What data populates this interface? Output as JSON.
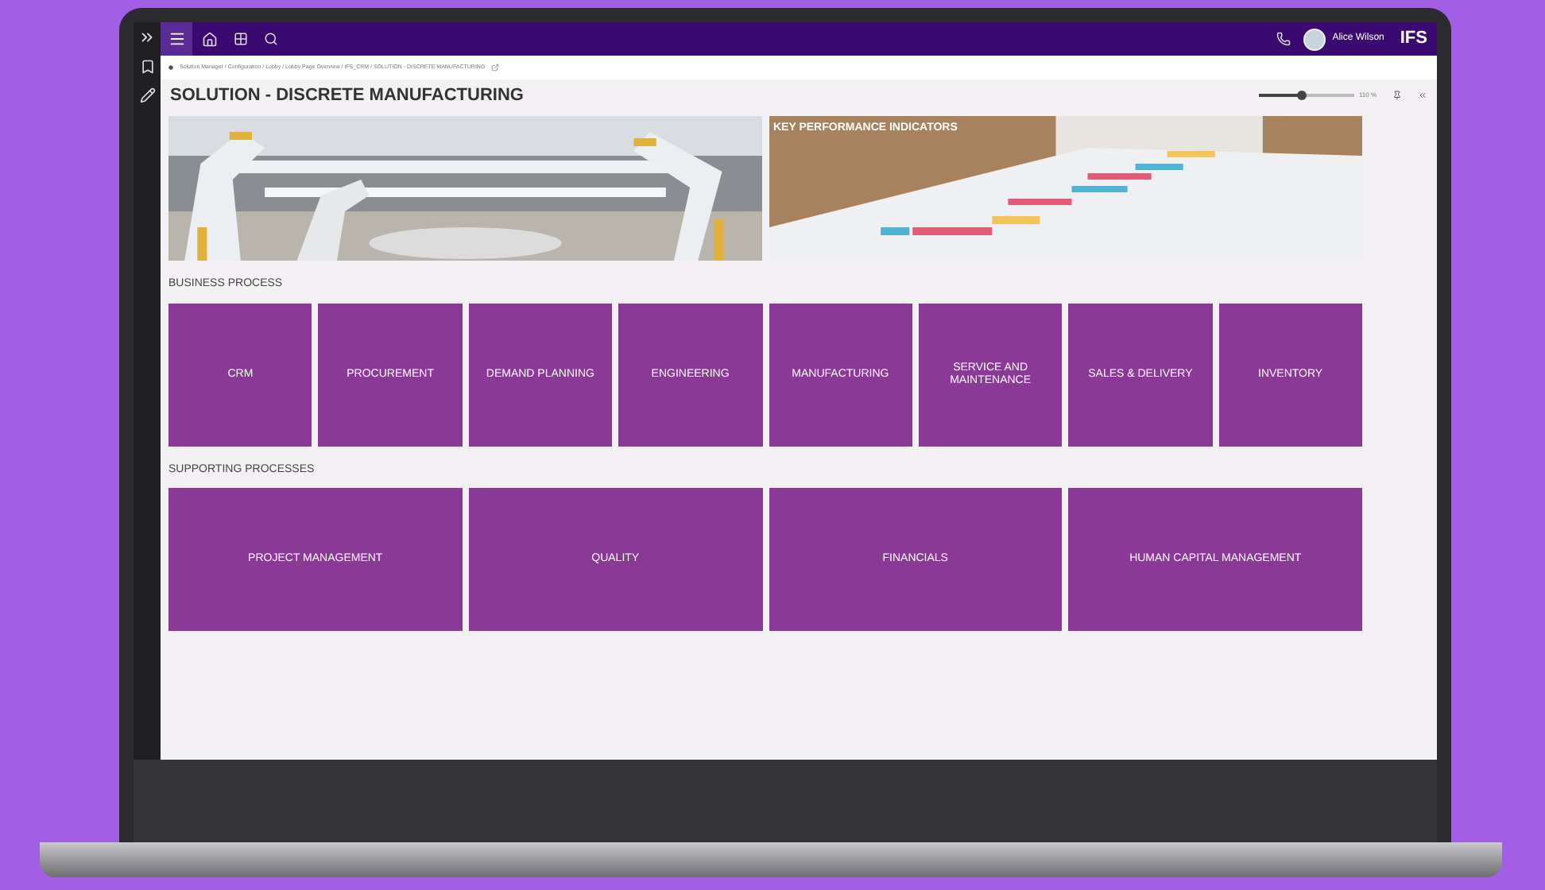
{
  "topbar": {
    "user": "Alice Wilson",
    "logo": "IFS"
  },
  "breadcrumb": "Solution Manager / Configuration / Lobby / Lobby Page Overview / IFS_CRM / SOLUTION - DISCRETE MANUFACTURING",
  "title": "SOLUTION - DISCRETE MANUFACTURING",
  "zoom": {
    "level": 0.45,
    "reading": "110 %"
  },
  "banners": [
    {
      "kind": "picture"
    },
    {
      "kind": "picture",
      "caption": "KEY PERFORMANCE INDICATORS"
    }
  ],
  "sections": [
    {
      "heading": "BUSINESS PROCESS",
      "tiles": [
        "CRM",
        "PROCUREMENT",
        "DEMAND PLANNING",
        "ENGINEERING",
        "MANUFACTURING",
        "SERVICE AND MAINTENANCE",
        "SALES & DELIVERY",
        "INVENTORY"
      ]
    },
    {
      "heading": "SUPPORTING PROCESSES",
      "tiles": [
        "PROJECT MANAGEMENT",
        "QUALITY",
        "FINANCIALS",
        "HUMAN CAPITAL MANAGEMENT"
      ]
    }
  ]
}
